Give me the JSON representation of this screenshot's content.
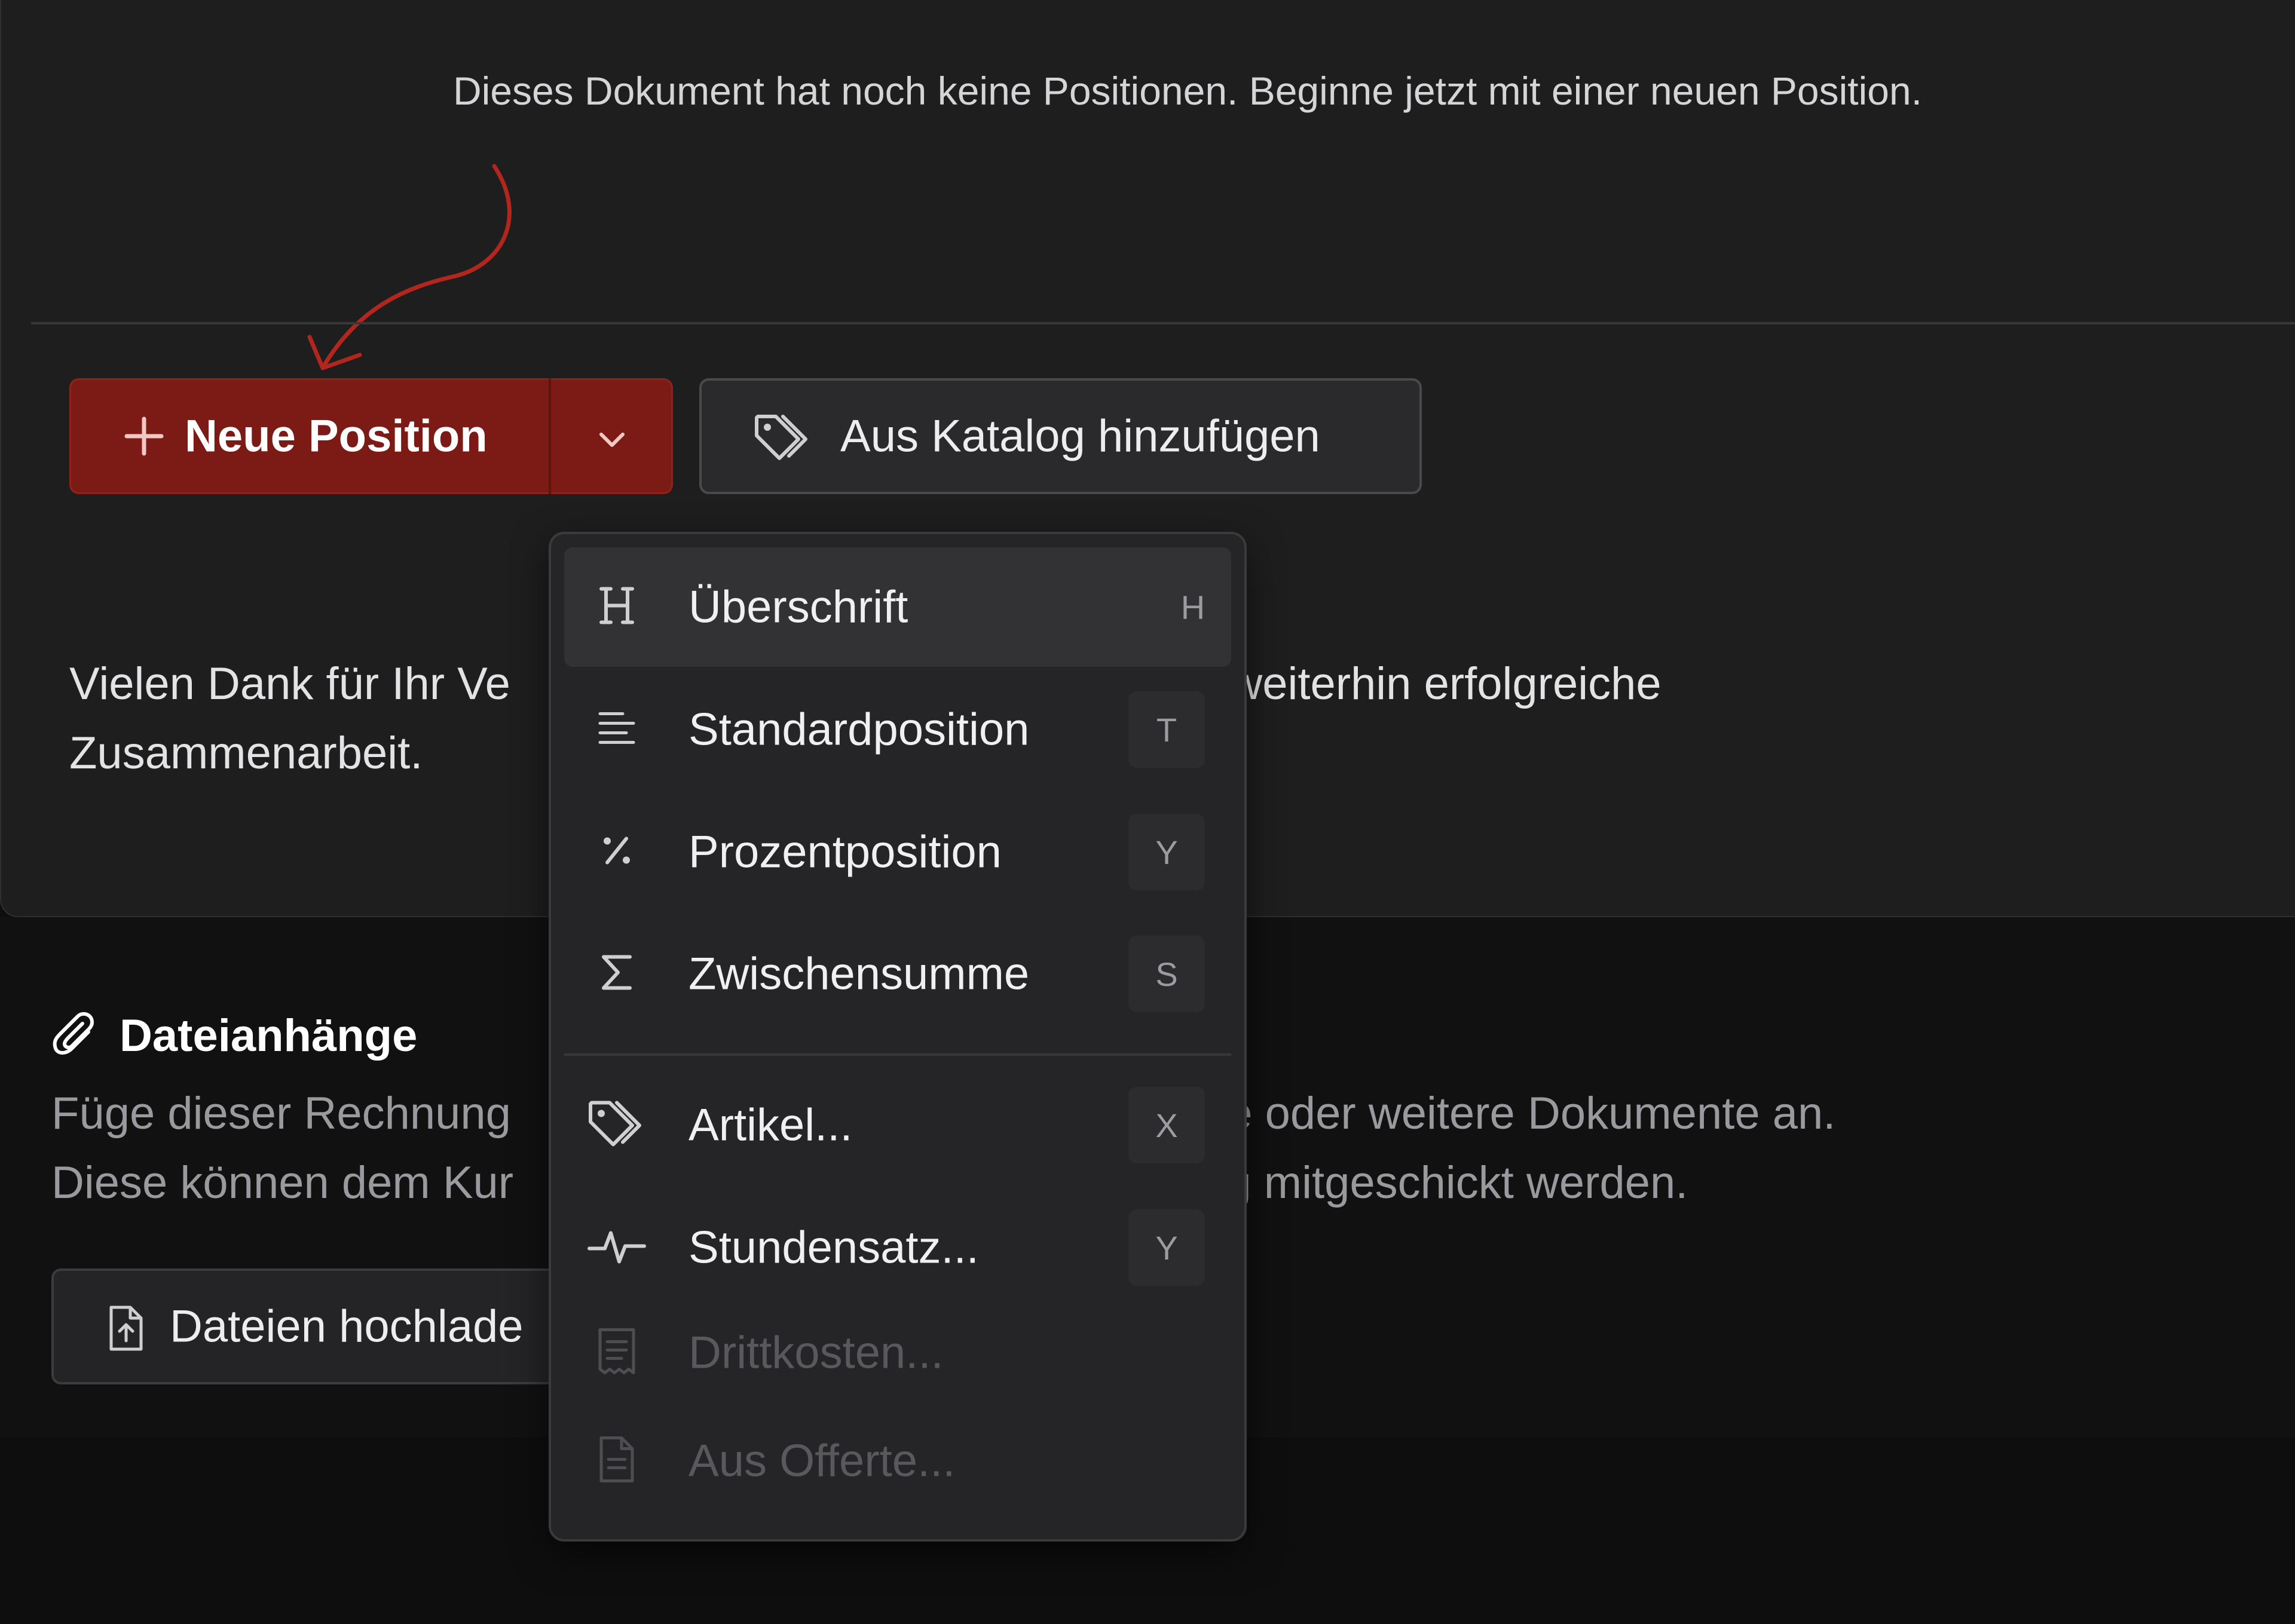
{
  "editor": {
    "empty_message": "Dieses Dokument hat noch keine Positionen. Beginne jetzt mit einer neuen Position.",
    "new_position_label": "Neue Position",
    "catalog_label": "Aus Katalog hinzufügen",
    "thanks_line1": "Vielen Dank für Ihr Ve",
    "thanks_line1_end": "e weiterhin erfolgreiche",
    "thanks_line2": "Zusammenarbeit."
  },
  "attachments": {
    "title": "Dateianhänge",
    "desc_line1_start": "Füge dieser Rechnung",
    "desc_line1_end": "ne oder weitere Dokumente an.",
    "desc_line2_start": "Diese können dem Kur",
    "desc_line2_end": "ng mitgeschickt werden.",
    "upload_label": "Dateien hochlade"
  },
  "menu": {
    "items": [
      {
        "label": "Überschrift",
        "shortcut": "H",
        "icon": "heading-icon",
        "active": true
      },
      {
        "label": "Standardposition",
        "shortcut": "T",
        "icon": "align-left-icon"
      },
      {
        "label": "Prozentposition",
        "shortcut": "Y",
        "icon": "percent-icon"
      },
      {
        "label": "Zwischensumme",
        "shortcut": "S",
        "icon": "sigma-icon"
      },
      {
        "label": "Artikel...",
        "shortcut": "X",
        "icon": "tag-icon"
      },
      {
        "label": "Stundensatz...",
        "shortcut": "Y",
        "icon": "pulse-icon"
      },
      {
        "label": "Drittkosten...",
        "icon": "receipt-icon",
        "disabled": true
      },
      {
        "label": "Aus Offerte...",
        "icon": "document-icon",
        "disabled": true
      }
    ]
  },
  "colors": {
    "primary": "#7c1a15",
    "background": "#0e0e0f",
    "card": "#1e1e1f",
    "menu": "#252527"
  }
}
